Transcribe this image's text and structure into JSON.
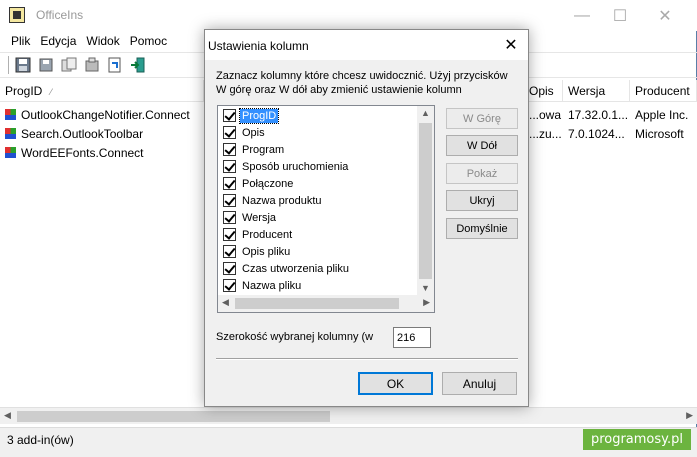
{
  "window": {
    "title": "OfficeIns",
    "minimize": "—",
    "maximize": "☐",
    "close": "✕"
  },
  "menu": [
    "Plik",
    "Edycja",
    "Widok",
    "Pomoc"
  ],
  "toolbar_icons": [
    "save-icon",
    "save-as-icon",
    "copy-icon",
    "properties-icon",
    "refresh-icon",
    "exit-icon"
  ],
  "list": {
    "columns": [
      "ProgID",
      "",
      "Opis",
      "Wersja",
      "Producent"
    ],
    "rows": [
      {
        "progid": "OutlookChangeNotifier.Connect",
        "opis": "...owa ...",
        "wersja": "17.32.0.1...",
        "producent": "Apple Inc."
      },
      {
        "progid": "Search.OutlookToolbar",
        "opis": "...zu...",
        "wersja": "7.0.1024...",
        "producent": "Microsoft"
      },
      {
        "progid": "WordEEFonts.Connect",
        "opis": "",
        "wersja": "",
        "producent": ""
      }
    ]
  },
  "status": {
    "text": "3 add-in(ów)",
    "watermark": "programosy.pl"
  },
  "dialog": {
    "title": "Ustawienia kolumn",
    "close": "✕",
    "instructions": "Zaznacz kolumny które chcesz uwidocznić. Użyj przycisków W górę oraz W dół aby zmienić ustawienie kolumn",
    "columns": [
      {
        "label": "ProgID",
        "checked": true,
        "selected": true
      },
      {
        "label": "Opis",
        "checked": true
      },
      {
        "label": "Program",
        "checked": true
      },
      {
        "label": "Sposób uruchomienia",
        "checked": true
      },
      {
        "label": "Połączone",
        "checked": true
      },
      {
        "label": "Nazwa produktu",
        "checked": true
      },
      {
        "label": "Wersja",
        "checked": true
      },
      {
        "label": "Producent",
        "checked": true
      },
      {
        "label": "Opis pliku",
        "checked": true
      },
      {
        "label": "Czas utworzenia pliku",
        "checked": true
      },
      {
        "label": "Nazwa pliku",
        "checked": true
      }
    ],
    "buttons": {
      "up": "W Górę",
      "down": "W Dół",
      "show": "Pokaż",
      "hide": "Ukryj",
      "default": "Domyślnie",
      "ok": "OK",
      "cancel": "Anuluj"
    },
    "width_label": "Szerokość wybranej kolumny (w",
    "width_value": "216"
  }
}
